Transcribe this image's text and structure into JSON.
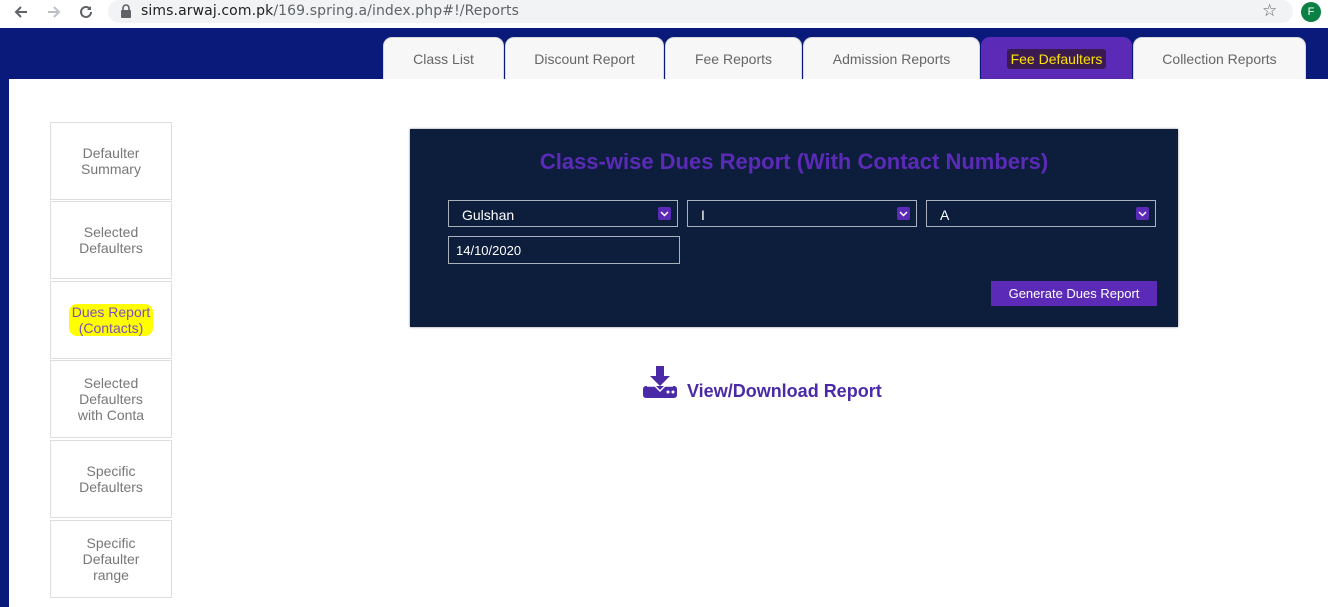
{
  "browser": {
    "url_host": "sims.arwaj.com.pk",
    "url_path": "/169.spring.a/index.php#!/Reports",
    "avatar_initial": "F"
  },
  "tabs": [
    {
      "label": "Class List"
    },
    {
      "label": "Discount Report"
    },
    {
      "label": "Fee Reports"
    },
    {
      "label": "Admission Reports"
    },
    {
      "label": "Fee Defaulters"
    },
    {
      "label": "Collection Reports"
    }
  ],
  "sidebar": {
    "items": [
      {
        "label": "Defaulter Summary"
      },
      {
        "label": "Selected Defaulters"
      },
      {
        "label": "Dues Report (Contacts)"
      },
      {
        "label": "Selected Defaulters with Conta"
      },
      {
        "label": "Specific Defaulters"
      },
      {
        "label": "Specific Defaulter range"
      }
    ]
  },
  "report": {
    "title": "Class-wise Dues Report (With Contact Numbers)",
    "campus": "Gulshan",
    "class": "I",
    "section": "A",
    "date": "14/10/2020",
    "generate_label": "Generate Dues Report",
    "download_label": "View/Download Report"
  },
  "colors": {
    "navy": "#0a1a7a",
    "panel": "#0c1e3c",
    "accent": "#5b2bb8",
    "highlight": "#ffff00"
  }
}
